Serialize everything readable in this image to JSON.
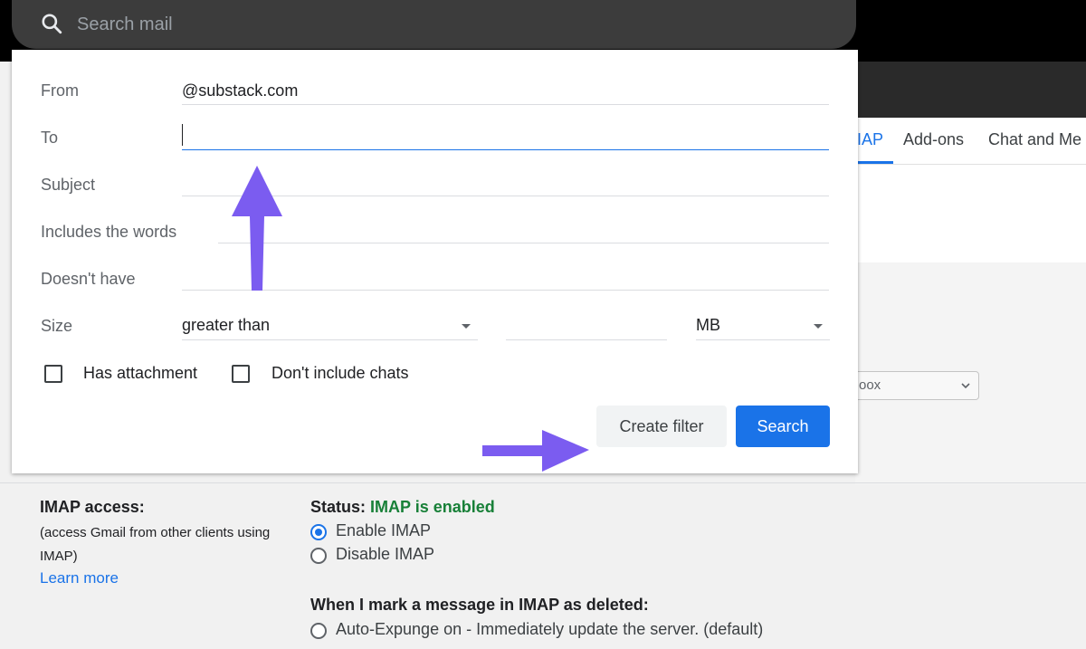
{
  "search": {
    "placeholder": "Search mail"
  },
  "tabs": [
    {
      "label": "IAP"
    },
    {
      "label": "Add-ons"
    },
    {
      "label": "Chat and Me"
    }
  ],
  "inbox_select": {
    "value": "oox"
  },
  "filter": {
    "from_label": "From",
    "from_value": "@substack.com",
    "to_label": "To",
    "to_value": "",
    "subject_label": "Subject",
    "includes_label": "Includes the words",
    "doesnt_have_label": "Doesn't have",
    "size_label": "Size",
    "size_comparator": "greater than",
    "size_value": "",
    "size_unit": "MB",
    "has_attachment_label": "Has attachment",
    "dont_include_chats_label": "Don't include chats",
    "create_filter_label": "Create filter",
    "search_label": "Search"
  },
  "imap": {
    "title": "IMAP access:",
    "description": "(access Gmail from other clients using IMAP)",
    "learn_more": "Learn more",
    "status_label": "Status:",
    "status_value": "IMAP is enabled",
    "enable_label": "Enable IMAP",
    "disable_label": "Disable IMAP",
    "deleted_title": "When I mark a message in IMAP as deleted:",
    "auto_expunge_on": "Auto-Expunge on - Immediately update the server. (default)"
  },
  "colors": {
    "accent": "#1a73e8",
    "annotation_arrow": "#7b5cf0",
    "status_ok": "#188038"
  }
}
